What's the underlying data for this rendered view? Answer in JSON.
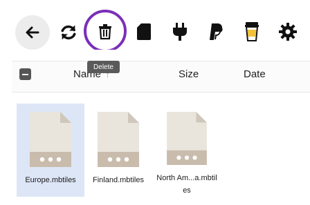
{
  "toolbar": {
    "buttons": [
      {
        "name": "back",
        "icon": "arrow-left-icon"
      },
      {
        "name": "refresh",
        "icon": "refresh-icon"
      },
      {
        "name": "delete",
        "icon": "trash-icon"
      },
      {
        "name": "sd-card",
        "icon": "sd-card-icon"
      },
      {
        "name": "plugin",
        "icon": "plug-icon"
      },
      {
        "name": "paypal",
        "icon": "paypal-icon"
      },
      {
        "name": "coffee",
        "icon": "coffee-cup-icon"
      },
      {
        "name": "settings",
        "icon": "gear-icon"
      }
    ],
    "tooltip": "Delete",
    "highlight_color": "#7a2fb8"
  },
  "table_header": {
    "columns": [
      {
        "label": "Name",
        "sort_indicator": "↑"
      },
      {
        "label": "Size"
      },
      {
        "label": "Date"
      }
    ]
  },
  "files": [
    {
      "label": "Europe.mbtiles",
      "selected": true
    },
    {
      "label": "Finland.mbtiles",
      "selected": false
    },
    {
      "label": "North Am...a.mbtiles",
      "selected": false
    }
  ]
}
